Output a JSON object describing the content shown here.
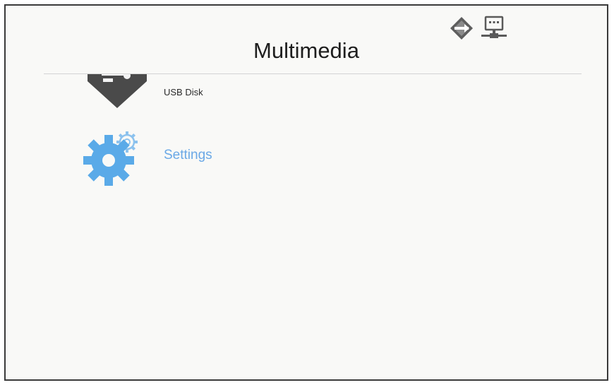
{
  "header": {
    "title": "Multimedia"
  },
  "status_icons": [
    {
      "icon": "network-diamond-icon"
    },
    {
      "icon": "lan-monitor-icon"
    }
  ],
  "menu": {
    "items": [
      {
        "label": "USB Disk",
        "icon": "usb-disk-icon",
        "selected": false
      },
      {
        "label": "Settings",
        "icon": "settings-gear-icon",
        "selected": true
      }
    ]
  },
  "colors": {
    "accent": "#6aa8e6",
    "icon_dark": "#4a4a4a",
    "background": "#f9f9f7"
  }
}
